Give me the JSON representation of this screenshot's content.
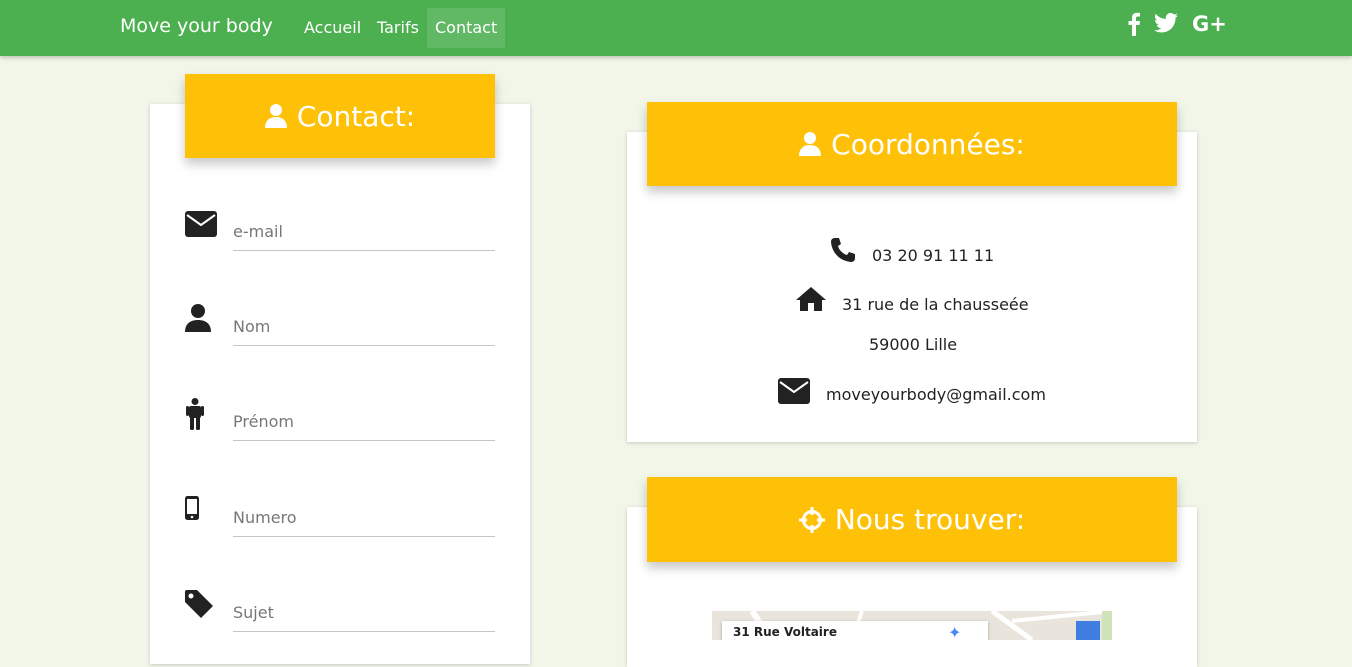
{
  "nav": {
    "brand": "Move your body",
    "links": [
      "Accueil",
      "Tarifs",
      "Contact"
    ],
    "active": "Contact",
    "social_icons": [
      "facebook-icon",
      "twitter-icon",
      "google-plus-icon"
    ]
  },
  "contact_card": {
    "title": "Contact:",
    "fields": [
      {
        "icon": "envelope-icon",
        "placeholder": "e-mail"
      },
      {
        "icon": "user-icon",
        "placeholder": "Nom"
      },
      {
        "icon": "person-icon",
        "placeholder": "Prénom"
      },
      {
        "icon": "mobile-icon",
        "placeholder": "Numero"
      },
      {
        "icon": "tag-icon",
        "placeholder": "Sujet"
      }
    ]
  },
  "coords_card": {
    "title": "Coordonnées:",
    "phone": "03 20 91 11 11",
    "address_line1": "31 rue de la chausseée",
    "address_line2": "59000 Lille",
    "email": "moveyourbody@gmail.com"
  },
  "find_card": {
    "title": "Nous trouver:",
    "map_label": "31 Rue Voltaire"
  },
  "colors": {
    "navbar": "#4caf50",
    "accent": "#ffc107",
    "page_bg": "#f1f6e9"
  }
}
